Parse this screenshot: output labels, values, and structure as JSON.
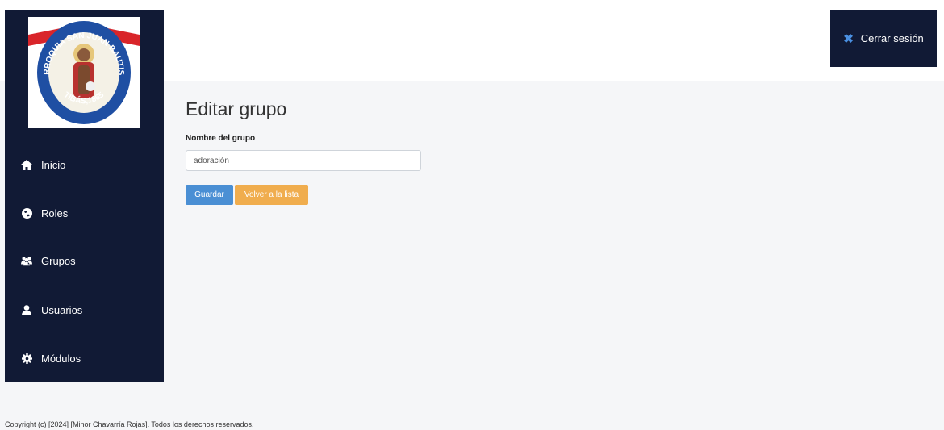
{
  "logo": {
    "top_text": "PARROQUIA SAN JUAN BAUTISTA",
    "bottom_text": "TIBÁS,1865"
  },
  "sidebar": {
    "items": [
      {
        "label": "Inicio",
        "icon": "home-icon"
      },
      {
        "label": "Roles",
        "icon": "globe-icon"
      },
      {
        "label": "Grupos",
        "icon": "users-icon"
      },
      {
        "label": "Usuarios",
        "icon": "user-icon"
      },
      {
        "label": "Módulos",
        "icon": "gear-icon"
      }
    ]
  },
  "header": {
    "logout_label": "Cerrar sesión",
    "logout_icon": "close-icon"
  },
  "main": {
    "title": "Editar grupo",
    "form": {
      "name_label": "Nombre del grupo",
      "name_value": "adoración"
    },
    "buttons": {
      "save_label": "Guardar",
      "back_label": "Volver a la lista"
    }
  },
  "footer": {
    "copyright": "Copyright (c) [2024] [Minor Chavarría Rojas]. Todos los derechos reservados."
  },
  "colors": {
    "sidebar_bg": "#111a35",
    "accent_blue": "#4a90e2",
    "primary_button": "#4a8fd4",
    "warning_button": "#f0ad4e",
    "page_bg": "#f5f6f8"
  }
}
